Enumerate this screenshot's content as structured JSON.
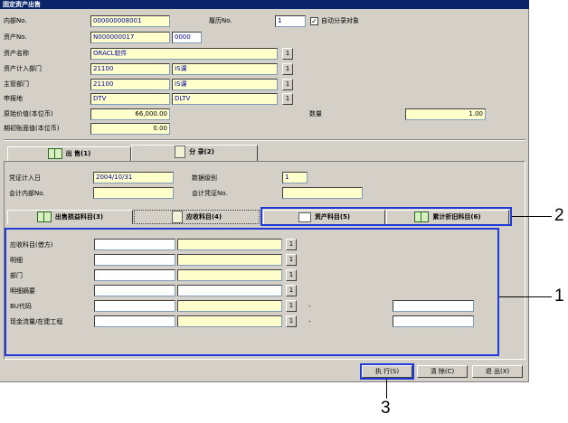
{
  "window": {
    "title": "固定资产出售"
  },
  "header": {
    "internal_no_label": "内部No.",
    "internal_no": "000000008001",
    "history_no_label": "履历No.",
    "history_no": "1",
    "auto_entry_label": "自动分录对象",
    "auto_entry_checked": "✓",
    "asset_no_label": "资产No.",
    "asset_no": "N000000017",
    "asset_sub_no": "0000",
    "asset_name_label": "资产名称",
    "asset_name": "ORACL软件",
    "account_dept_label": "资产计入部门",
    "account_dept_code": "21100",
    "account_dept_name": "IS课",
    "main_dept_label": "主管部门",
    "main_dept_code": "21100",
    "main_dept_name": "IS课",
    "location_label": "申报地",
    "location_code": "DTV",
    "location_name": "DLTV",
    "original_value_label": "原始价值(本位币)",
    "original_value": "66,000.00",
    "quantity_label": "数量",
    "quantity": "1.00",
    "book_value_label": "期初账面值(本位币)",
    "book_value": "0.00",
    "lookup_label": "1"
  },
  "main_tabs": [
    {
      "label": "出  售(1)",
      "icon": "book-icon"
    },
    {
      "label": "分  录(2)",
      "icon": "document-icon"
    }
  ],
  "voucher": {
    "date_label": "凭证计入日",
    "date": "2004/10/31",
    "data_level_label": "数据级别",
    "data_level": "1",
    "internal_no_label": "会计内部No.",
    "voucher_no_label": "会计凭证No."
  },
  "sub_tabs": [
    {
      "label": "出售损益科目(3)",
      "icon": "book-icon"
    },
    {
      "label": "应收科目(4)",
      "icon": "document-icon"
    },
    {
      "label": "资产科目(5)",
      "icon": "window-icon"
    },
    {
      "label": "累计折旧科目(6)",
      "icon": "book-icon"
    }
  ],
  "entry_rows": [
    {
      "label": "应收科目(借方)"
    },
    {
      "label": "明细"
    },
    {
      "label": "部门"
    },
    {
      "label": "明细摘要"
    },
    {
      "label": "BU代码",
      "dash": "-"
    },
    {
      "label": "现金流量/在建工程",
      "dash": "-"
    }
  ],
  "buttons": {
    "execute": "执  行(S)",
    "clear": "清  除(C)",
    "exit": "退  出(X)"
  },
  "callouts": {
    "one": "1",
    "two": "2",
    "three": "3"
  },
  "colors": {
    "title_bar": "#0a246a",
    "highlight": "#1f3ad6",
    "required_field": "#ffffcc"
  }
}
